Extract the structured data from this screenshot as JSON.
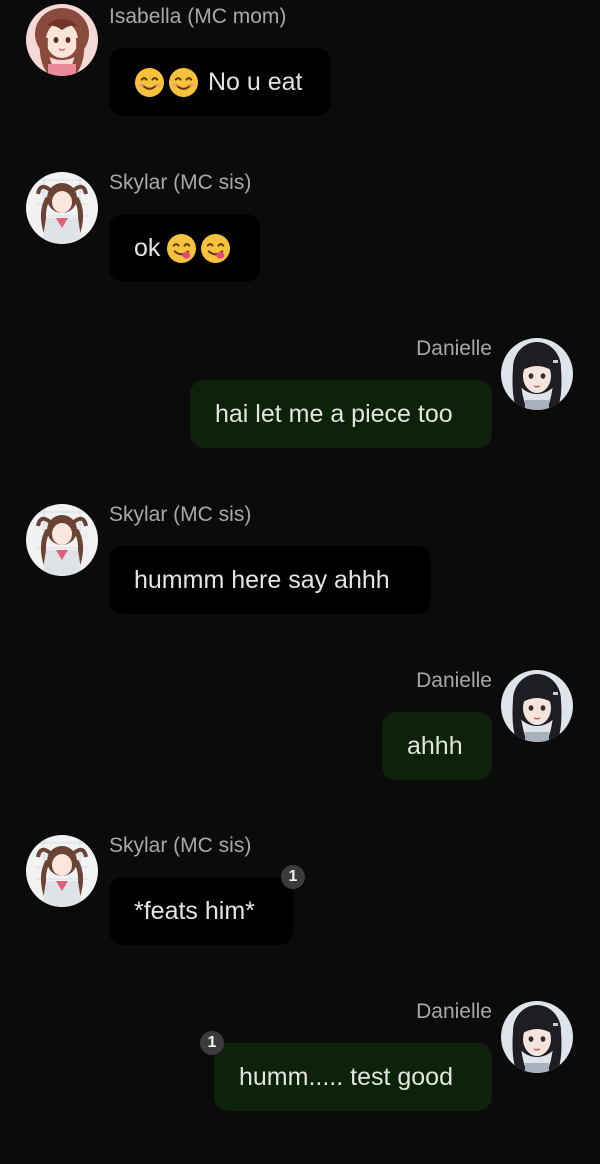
{
  "messages": [
    {
      "sender": "Isabella (MC mom)",
      "text": "No u eat",
      "emoji_before": [
        "smiling-face-emoji",
        "smiling-face-emoji"
      ],
      "direction": "incoming"
    },
    {
      "sender": "Skylar (MC sis)",
      "text": "ok",
      "emoji_after": [
        "yum-face-emoji",
        "yum-face-emoji"
      ],
      "direction": "incoming"
    },
    {
      "sender": "Danielle",
      "text": "hai let me a piece too",
      "direction": "outgoing"
    },
    {
      "sender": "Skylar (MC sis)",
      "text": "hummm here say ahhh",
      "direction": "incoming"
    },
    {
      "sender": "Danielle",
      "text": "ahhh",
      "direction": "outgoing"
    },
    {
      "sender": "Skylar (MC sis)",
      "text": "*feats him*",
      "badge": "1",
      "direction": "incoming"
    },
    {
      "sender": "Danielle",
      "text": "humm..... test good",
      "badge": "1",
      "direction": "outgoing"
    }
  ],
  "colors": {
    "background": "#0b0b0b",
    "incoming_bubble": "#000000",
    "outgoing_bubble": "#0e210a",
    "sender_name": "#a8a8a8",
    "badge": "#3b3b3b"
  }
}
